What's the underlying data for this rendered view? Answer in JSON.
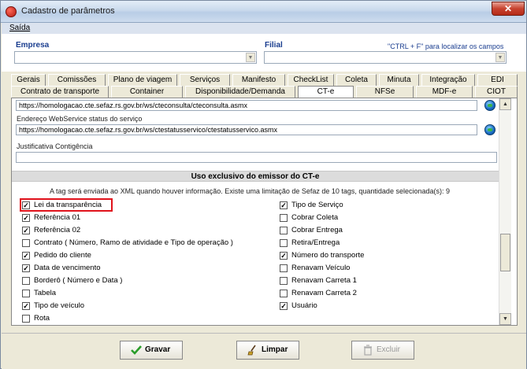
{
  "window": {
    "title": "Cadastro de parâmetros",
    "close_glyph": "✕"
  },
  "menu": {
    "saida": "Saída"
  },
  "top": {
    "empresa_label": "Empresa",
    "filial_label": "Filial",
    "hint": "\"CTRL + F\" para localizar os campos",
    "empresa_value": "",
    "filial_value": ""
  },
  "tabs_row1": [
    "Gerais",
    "Comissões",
    "Plano de viagem",
    "Serviços",
    "Manifesto",
    "CheckList",
    "Coleta",
    "Minuta",
    "Integração",
    "EDI"
  ],
  "tabs_row2": [
    "Contrato de transporte",
    "Container",
    "Disponibilidade/Demanda",
    "CT-e",
    "NFSe",
    "MDF-e",
    "CIOT"
  ],
  "active_tab": "CT-e",
  "fields": {
    "consulta_url": "https://homologacao.cte.sefaz.rs.gov.br/ws/cteconsulta/cteconsulta.asmx",
    "status_label": "Endereço WebService status do serviço",
    "status_url": "https://homologacao.cte.sefaz.rs.gov.br/ws/ctestatusservico/ctestatusservico.asmx",
    "justificativa_label": "Justificativa Contigência",
    "justificativa_value": ""
  },
  "section": {
    "title": "Uso exclusivo do emissor do CT-e",
    "info": "A tag será enviada ao XML quando houver informação. Existe uma limitação de Sefaz de 10 tags, quantidade selecionada(s): 9"
  },
  "checkboxes_left": [
    {
      "label": "Lei da transparência",
      "checked": true
    },
    {
      "label": "Referência 01",
      "checked": true
    },
    {
      "label": "Referência 02",
      "checked": true
    },
    {
      "label": "Contrato ( Número, Ramo de atividade e Tipo de operação )",
      "checked": false
    },
    {
      "label": "Pedido do cliente",
      "checked": true
    },
    {
      "label": "Data de vencimento",
      "checked": true
    },
    {
      "label": "Borderô ( Número e Data )",
      "checked": false
    },
    {
      "label": "Tabela",
      "checked": false
    },
    {
      "label": "Tipo de veículo",
      "checked": true
    },
    {
      "label": "Rota",
      "checked": false
    }
  ],
  "checkboxes_right": [
    {
      "label": "Tipo de Serviço",
      "checked": true
    },
    {
      "label": "Cobrar Coleta",
      "checked": false
    },
    {
      "label": "Cobrar Entrega",
      "checked": false
    },
    {
      "label": "Retira/Entrega",
      "checked": false
    },
    {
      "label": "Número do transporte",
      "checked": true
    },
    {
      "label": "Renavam Veículo",
      "checked": false
    },
    {
      "label": "Renavam Carreta 1",
      "checked": false
    },
    {
      "label": "Renavam Carreta 2",
      "checked": false
    },
    {
      "label": "Usuário",
      "checked": true
    }
  ],
  "buttons": {
    "gravar": "Gravar",
    "limpar": "Limpar",
    "excluir": "Excluir"
  }
}
